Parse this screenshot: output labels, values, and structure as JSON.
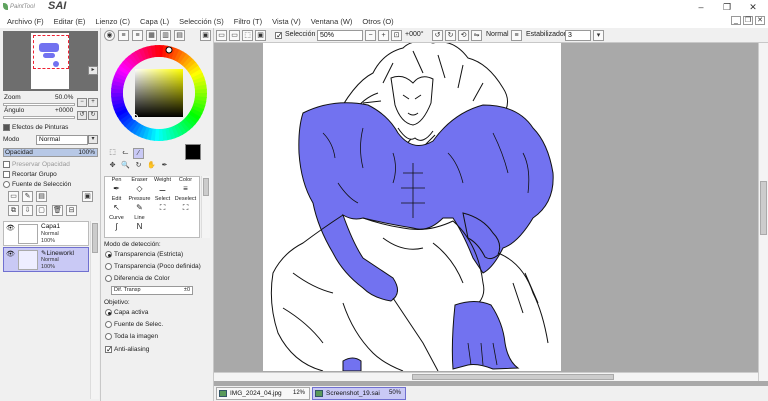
{
  "app": {
    "brand_small": "PaintTool",
    "name": "SAI"
  },
  "menu": [
    "Archivo (F)",
    "Editar (E)",
    "Lienzo (C)",
    "Capa (L)",
    "Selección (S)",
    "Filtro (T)",
    "Vista (V)",
    "Ventana (W)",
    "Otros (O)"
  ],
  "navigator": {
    "zoom_label": "Zoom",
    "zoom_value": "50.0%",
    "angle_label": "Ángulo",
    "angle_value": "+0000"
  },
  "layer_panel": {
    "effects_label": "Efectos de Pinturas",
    "mode_label": "Modo",
    "mode_value": "Normal",
    "opacity_label": "Opacidad",
    "opacity_value": "100%",
    "opacity_level": 1.0,
    "preserve_opacity": "Preservar Opacidad",
    "clip_group": "Recortar Grupo",
    "selection_source": "Fuente de Selección",
    "layers": [
      {
        "name": "Capa1",
        "mode": "Normal",
        "opacity": "100%",
        "selected": false
      },
      {
        "name": "Lineworkl",
        "mode": "Normal",
        "opacity": "100%",
        "selected": true
      }
    ]
  },
  "tools": {
    "brush_headers": [
      "Pen",
      "Eraser",
      "Weight",
      "Color"
    ],
    "brush_headers_2": [
      "Edit",
      "Pressure",
      "Select",
      "Deselect"
    ],
    "brush_headers_3": [
      "Curve",
      "Line"
    ],
    "detection": {
      "title": "Modo de detección:",
      "options": [
        "Transparencia (Estricta)",
        "Transparencia (Poco definida)",
        "Diferencia de Color"
      ],
      "selected": 0,
      "diff_label": "Dif. Transp",
      "diff_value": "±0"
    },
    "target": {
      "title": "Objetivo:",
      "options": [
        "Capa activa",
        "Fuente de Selec.",
        "Toda la imagen"
      ],
      "selected": 0
    },
    "antialias": "Anti-aliasing"
  },
  "canvas_toolbar": {
    "selection_label": "Selección",
    "zoom": "50%",
    "angle": "+000°",
    "blend": "Normal",
    "stabilizer_label": "Estabilizador",
    "stabilizer_value": "3"
  },
  "tabs": [
    {
      "name": "IMG_2024_04.jpg",
      "zoom": "12%",
      "active": false
    },
    {
      "name": "Screenshot_19.sai",
      "zoom": "50%",
      "active": true
    }
  ],
  "colors": {
    "accent": "#7272f0",
    "primary_color": "#000000",
    "secondary_color": "#ff00ff"
  }
}
